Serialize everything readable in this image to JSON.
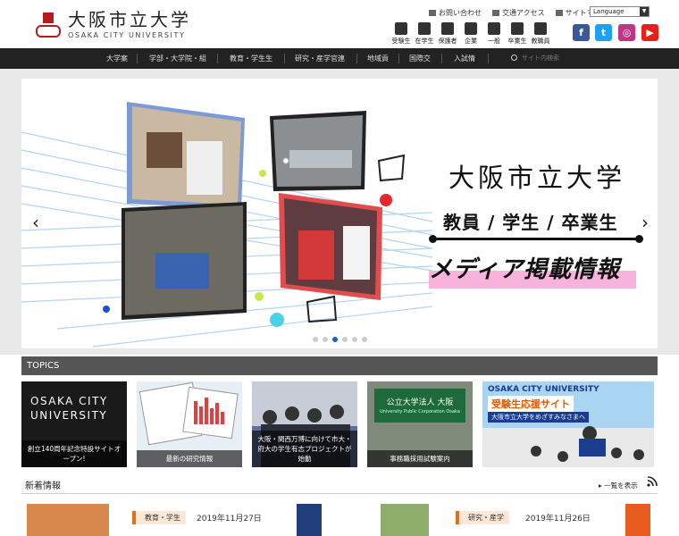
{
  "header": {
    "logo_jp": "大阪市立大学",
    "logo_en": "OSAKA CITY UNIVERSITY",
    "util_links": [
      "お問い合わせ",
      "交通アクセス",
      "サイトマップ"
    ],
    "language_label": "Language",
    "targets": [
      "受験生",
      "在学生",
      "保護者",
      "企業",
      "一般",
      "卒業生",
      "教職員"
    ],
    "social": [
      {
        "name": "facebook-icon",
        "glyph": "f",
        "color": "#3b5998"
      },
      {
        "name": "twitter-icon",
        "glyph": "t",
        "color": "#1da1f2"
      },
      {
        "name": "instagram-icon",
        "glyph": "◎",
        "color": "#c13584"
      },
      {
        "name": "youtube-icon",
        "glyph": "▶",
        "color": "#e62117"
      }
    ]
  },
  "gnav": {
    "items": [
      "大学案",
      "学部・大学院・組",
      "教育・学生生",
      "研究・産学官連",
      "地域貢",
      "国際交",
      "入試情"
    ],
    "search_placeholder": "サイト内検索"
  },
  "hero": {
    "title": "大阪市立大学",
    "subtitle": "教員 / 学生 / 卒業生",
    "media": "メディア掲載情報",
    "prev": "‹",
    "next": "›",
    "slide_count": 6,
    "active_slide": 3
  },
  "topics": {
    "heading": "TOPICS",
    "items": [
      {
        "caption": "創立140周年記念特設サイトオープン!",
        "title_line1": "OSAKA CITY",
        "title_line2": "UNIVERSITY"
      },
      {
        "caption": "最新の研究情報"
      },
      {
        "caption": "大阪・関西万博に向けて市大・府大の学生有志プロジェクトが始動"
      },
      {
        "caption": "事務職採用試験案内",
        "sign_line1": "公立大学法人 大阪",
        "sign_line2": "University Public Corporation Osaka"
      },
      {
        "caption": "",
        "banner1": "OSAKA CITY UNIVERSITY",
        "banner2": "受験生応援サイト",
        "banner3": "大阪市立大学をめざすみなさまへ"
      }
    ]
  },
  "news": {
    "heading": "新着情報",
    "more_label": "一覧を表示",
    "cards": [
      {
        "category": "教育・学生",
        "date": "2019年11月27日"
      },
      {
        "category": "研究・産学",
        "date": "2019年11月26日"
      }
    ]
  },
  "colors": {
    "gnav_bg": "#222222",
    "topics_head": "#555555",
    "accent_pink": "#f7b3dc",
    "accent_blue": "#1565c0"
  }
}
